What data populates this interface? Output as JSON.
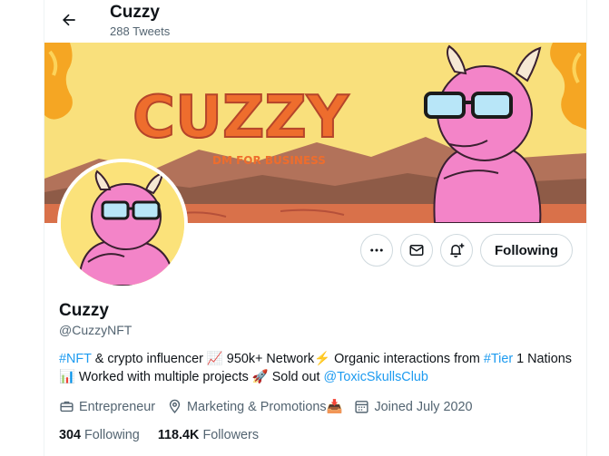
{
  "header": {
    "name": "Cuzzy",
    "tweet_count": "288 Tweets"
  },
  "banner": {
    "title": "CUZZY",
    "subtitle": "DM FOR BUSINESS",
    "bg_color": "#f9e07c",
    "title_color": "#ee6d2d",
    "character_color": "#f384c8"
  },
  "profile": {
    "name": "Cuzzy",
    "handle": "@CuzzyNFT",
    "bio": {
      "nft_tag": "#NFT",
      "text1": " & crypto influencer 📈 950k+ Network⚡ Organic interactions from ",
      "tier_tag": "#Tier",
      "text2": " 1 Nations 📊 Worked with multiple projects 🚀 Sold out ",
      "mention": "@ToxicSkullsClub"
    },
    "meta": {
      "category": "Entrepreneur",
      "location": "Marketing & Promotions📥",
      "joined": "Joined July 2020"
    },
    "stats": {
      "following_count": "304",
      "following_label": "Following",
      "followers_count": "118.4K",
      "followers_label": "Followers"
    }
  },
  "actions": {
    "follow_label": "Following",
    "more_icon": "more-icon",
    "message_icon": "message-icon",
    "notify_icon": "notify-icon"
  },
  "colors": {
    "accent": "#1d9bf0",
    "secondary_text": "#536471"
  }
}
